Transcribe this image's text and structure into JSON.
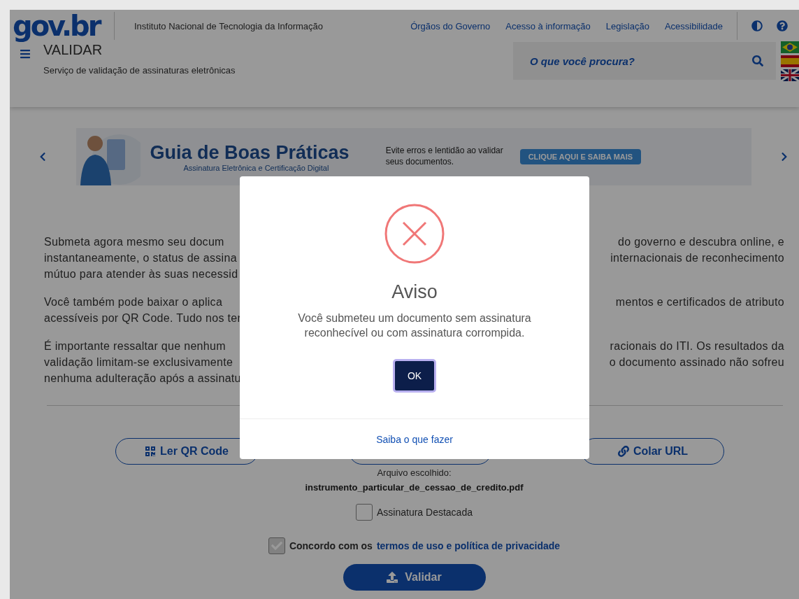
{
  "header": {
    "logo": "gov.br",
    "institution": "Instituto Nacional de Tecnologia da Informação",
    "links": [
      "Órgãos do Governo",
      "Acesso à informação",
      "Legislação",
      "Acessibilidade"
    ],
    "title": "VALIDAR",
    "subtitle": "Serviço de validação de assinaturas eletrônicas",
    "search": {
      "placeholder": "O que você procura?"
    }
  },
  "banner": {
    "title": "Guia de Boas Práticas",
    "subtitle": "Assinatura Eletrônica e Certificação Digital",
    "note": "Evite erros e lentidão ao validar seus documentos.",
    "cta": "CLIQUE AQUI E SAIBA MAIS"
  },
  "paragraphs": [
    [
      {
        "left": "Submeta agora mesmo seu docum",
        "right": "do governo e descubra online, e"
      },
      {
        "left": "instantaneamente, o status de assina",
        "right": "internacionais de reconhecimento"
      },
      {
        "left": "mútuo para atender às suas necessid"
      }
    ],
    [
      {
        "left": "Você também pode baixar o aplica",
        "right": "mentos e certificados de atributo"
      },
      {
        "left": "acessíveis por QR Code. Tudo nos ter"
      }
    ],
    [
      {
        "left": "É importante ressaltar que nenhum",
        "right": "racionais do ITI. Os resultados da"
      },
      {
        "left": "validação limitam-se exclusivamente",
        "right": "o documento assinado não sofreu"
      },
      {
        "left": "nenhuma adulteração após a assinatu"
      }
    ]
  ],
  "actions": [
    {
      "kind": "qr",
      "label": "Ler QR Code"
    },
    {
      "kind": "upload"
    },
    {
      "kind": "url",
      "label": "Colar URL"
    }
  ],
  "file": {
    "caption": "Arquivo escolhido:",
    "name": "instrumento_particular_de_cessao_de_credito.pdf"
  },
  "detached": {
    "label": "Assinatura Destacada",
    "checked": false
  },
  "terms": {
    "text": "Concordo com os",
    "link": "termos de uso e política de privacidade",
    "checked": true
  },
  "submit": "Validar",
  "modal": {
    "title": "Aviso",
    "message": "Você submeteu um documento sem assinatura reconhecível ou com assinatura corrompida.",
    "ok": "OK",
    "link": "Saiba o que fazer"
  }
}
